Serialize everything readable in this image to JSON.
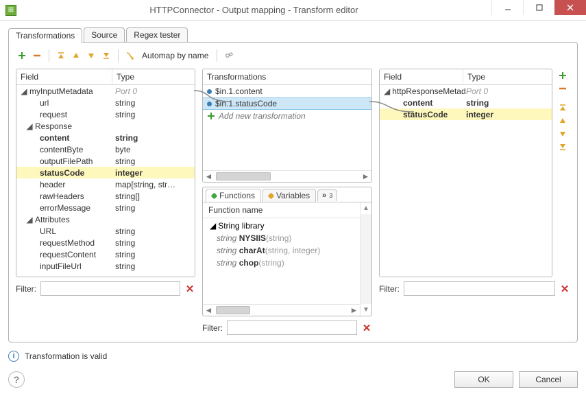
{
  "window": {
    "title": "HTTPConnector - Output mapping - Transform editor"
  },
  "tabs": {
    "t1": "Transformations",
    "t2": "Source",
    "t3": "Regex tester"
  },
  "toolbar": {
    "automap": "Automap by name"
  },
  "left": {
    "hdr_field": "Field",
    "hdr_type": "Type",
    "port": "Port 0",
    "rows": {
      "myInputMetadata": "myInputMetadata",
      "url": "url",
      "url_t": "string",
      "request": "request",
      "request_t": "string",
      "Response": "Response",
      "content": "content",
      "content_t": "string",
      "contentByte": "contentByte",
      "contentByte_t": "byte",
      "outputFilePath": "outputFilePath",
      "outputFilePath_t": "string",
      "statusCode": "statusCode",
      "statusCode_t": "integer",
      "header": "header",
      "header_t": "map[string, str…",
      "rawHeaders": "rawHeaders",
      "rawHeaders_t": "string[]",
      "errorMessage": "errorMessage",
      "errorMessage_t": "string",
      "Attributes": "Attributes",
      "URL": "URL",
      "URL_t": "string",
      "requestMethod": "requestMethod",
      "requestMethod_t": "string",
      "requestContent": "requestContent",
      "requestContent_t": "string",
      "inputFileUrl": "inputFileUrl",
      "inputFileUrl_t": "string"
    }
  },
  "mid": {
    "trans_hdr": "Transformations",
    "t1": "$in.1.content",
    "t2": "$in.1.statusCode",
    "add": "Add new transformation",
    "ftab1": "Functions",
    "ftab2": "Variables",
    "ftab3": "3",
    "fn_hdr": "Function name",
    "fgroup": "String library",
    "f1_ret": "string ",
    "f1_name": "NYSIIS",
    "f1_args": "(string)",
    "f2_ret": "string ",
    "f2_name": "charAt",
    "f2_args": "(string, integer)",
    "f3_ret": "string ",
    "f3_name": "chop",
    "f3_args": "(string)"
  },
  "right": {
    "hdr_field": "Field",
    "hdr_type": "Type",
    "port": "Port 0",
    "meta": "httpResponseMetad",
    "content": "content",
    "content_t": "string",
    "statusCode": "statusCode",
    "statusCode_t": "integer"
  },
  "filter": {
    "label": "Filter:"
  },
  "status": {
    "text": "Transformation is valid"
  },
  "buttons": {
    "ok": "OK",
    "cancel": "Cancel"
  }
}
